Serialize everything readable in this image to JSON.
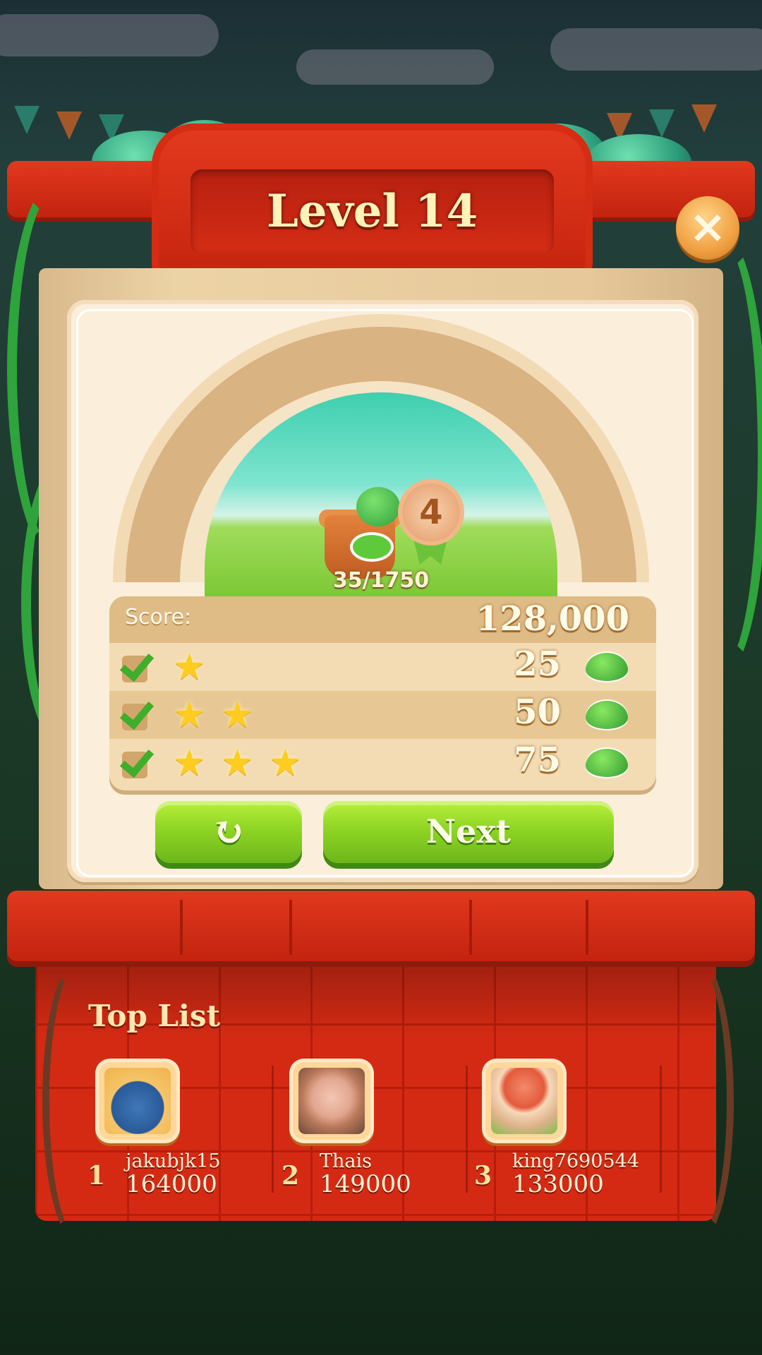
{
  "header": {
    "title": "Level 14",
    "close_icon": "close-icon"
  },
  "level_preview": {
    "progress": "35/1750",
    "badge_number": "4"
  },
  "score_table": {
    "score_label": "Score:",
    "score_value": "128,000",
    "tiers": [
      {
        "stars": 1,
        "achieved": true,
        "reward": "25"
      },
      {
        "stars": 2,
        "achieved": true,
        "reward": "50"
      },
      {
        "stars": 3,
        "achieved": true,
        "reward": "75"
      }
    ],
    "reward_icon": "leaf-icon"
  },
  "buttons": {
    "retry_icon": "retry-icon",
    "retry_glyph": "↻",
    "next_label": "Next"
  },
  "top_list": {
    "title": "Top List",
    "entries": [
      {
        "rank": "1",
        "name": "jakubjk15",
        "score": "164000"
      },
      {
        "rank": "2",
        "name": "Thais",
        "score": "149000"
      },
      {
        "rank": "3",
        "name": "king7690544",
        "score": "133000"
      }
    ]
  },
  "colors": {
    "brick_red": "#d42a14",
    "button_green": "#8fd524",
    "paper": "#fbeedb",
    "star_gold": "#ffcc1f"
  }
}
